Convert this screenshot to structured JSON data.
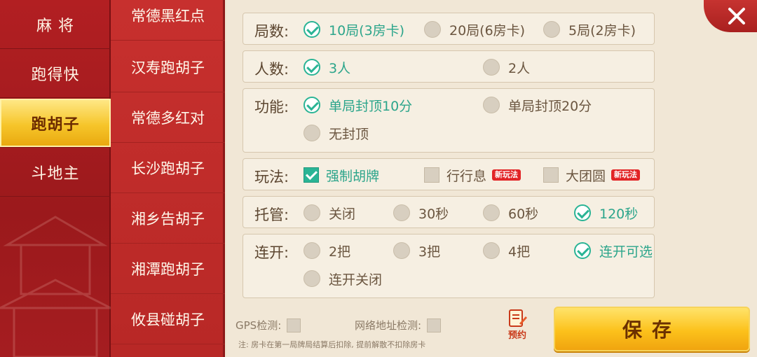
{
  "categories": [
    {
      "label": "麻  将",
      "active": false
    },
    {
      "label": "跑得快",
      "active": false
    },
    {
      "label": "跑胡子",
      "active": true
    },
    {
      "label": "斗地主",
      "active": false
    }
  ],
  "games": [
    "常德黑红点",
    "汉寿跑胡子",
    "常德多红对",
    "长沙跑胡子",
    "湘乡告胡子",
    "湘潭跑胡子",
    "攸县碰胡子"
  ],
  "groups": {
    "rounds": {
      "label": "局数:",
      "options": [
        "10局(3房卡)",
        "20局(6房卡)",
        "5局(2房卡)"
      ]
    },
    "players": {
      "label": "人数:",
      "options": [
        "3人",
        "2人"
      ]
    },
    "function": {
      "label": "功能:",
      "options": [
        "单局封顶10分",
        "单局封顶20分",
        "无封顶"
      ]
    },
    "play": {
      "label": "玩法:",
      "options": [
        "强制胡牌",
        "行行息",
        "大团圆"
      ],
      "badge": "新玩法"
    },
    "auto": {
      "label": "托管:",
      "options": [
        "关闭",
        "30秒",
        "60秒",
        "120秒"
      ]
    },
    "continue": {
      "label": "连开:",
      "options": [
        "2把",
        "3把",
        "4把",
        "连开可选",
        "连开关闭"
      ]
    }
  },
  "bottom": {
    "gps": "GPS检测:",
    "ip": "网络地址检测:",
    "reserve": "预约",
    "save": "保存",
    "note": "注: 房卡在第一局牌局结算后扣除, 提前解散不扣除房卡"
  },
  "colors": {
    "accent": "#2ab495",
    "red": "#b21f22",
    "gold": "#fcc11b"
  }
}
